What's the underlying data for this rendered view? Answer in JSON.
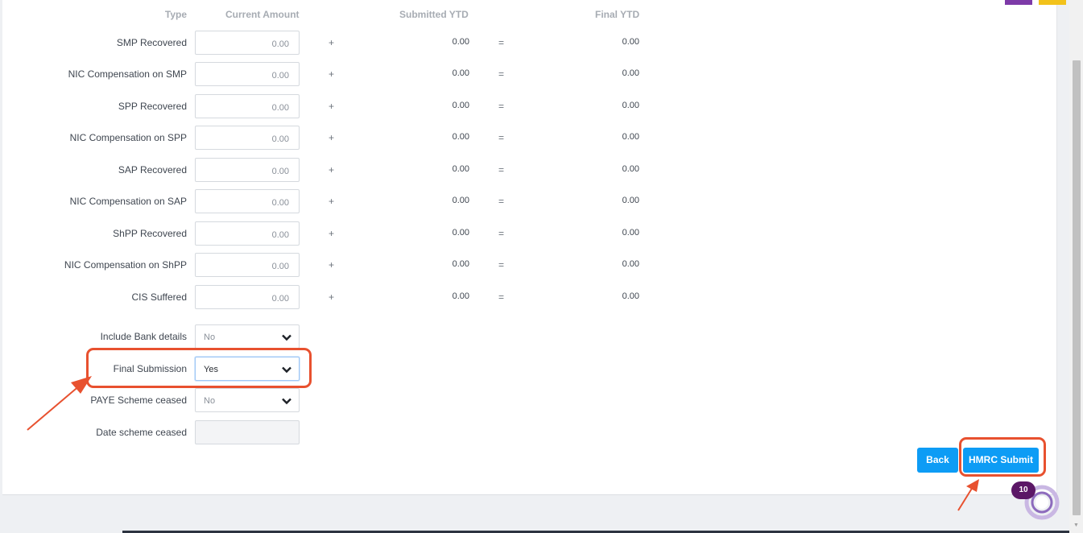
{
  "headers": {
    "type": "Type",
    "current": "Current Amount",
    "submitted": "Submitted YTD",
    "final": "Final YTD"
  },
  "rows": [
    {
      "label": "SMP Recovered",
      "current": "0.00",
      "plus": "+",
      "submitted": "0.00",
      "equals": "=",
      "final": "0.00"
    },
    {
      "label": "NIC Compensation on SMP",
      "current": "0.00",
      "plus": "+",
      "submitted": "0.00",
      "equals": "=",
      "final": "0.00"
    },
    {
      "label": "SPP Recovered",
      "current": "0.00",
      "plus": "+",
      "submitted": "0.00",
      "equals": "=",
      "final": "0.00"
    },
    {
      "label": "NIC Compensation on SPP",
      "current": "0.00",
      "plus": "+",
      "submitted": "0.00",
      "equals": "=",
      "final": "0.00"
    },
    {
      "label": "SAP Recovered",
      "current": "0.00",
      "plus": "+",
      "submitted": "0.00",
      "equals": "=",
      "final": "0.00"
    },
    {
      "label": "NIC Compensation on SAP",
      "current": "0.00",
      "plus": "+",
      "submitted": "0.00",
      "equals": "=",
      "final": "0.00"
    },
    {
      "label": "ShPP Recovered",
      "current": "0.00",
      "plus": "+",
      "submitted": "0.00",
      "equals": "=",
      "final": "0.00"
    },
    {
      "label": "NIC Compensation on ShPP",
      "current": "0.00",
      "plus": "+",
      "submitted": "0.00",
      "equals": "=",
      "final": "0.00"
    },
    {
      "label": "CIS Suffered",
      "current": "0.00",
      "plus": "+",
      "submitted": "0.00",
      "equals": "=",
      "final": "0.00"
    }
  ],
  "include_bank": {
    "label": "Include Bank details",
    "value": "No"
  },
  "final_submission": {
    "label": "Final Submission",
    "value": "Yes"
  },
  "paye_ceased": {
    "label": "PAYE Scheme ceased",
    "value": "No"
  },
  "date_ceased": {
    "label": "Date scheme ceased",
    "value": ""
  },
  "buttons": {
    "back": "Back",
    "submit": "HMRC Submit"
  },
  "notification": {
    "count": "10"
  },
  "colors": {
    "accent": "#0d9cf5",
    "annotation": "#e8512f",
    "badge": "#5b1766",
    "corner_purple": "#7d3aa8",
    "corner_yellow": "#f2c21b"
  }
}
